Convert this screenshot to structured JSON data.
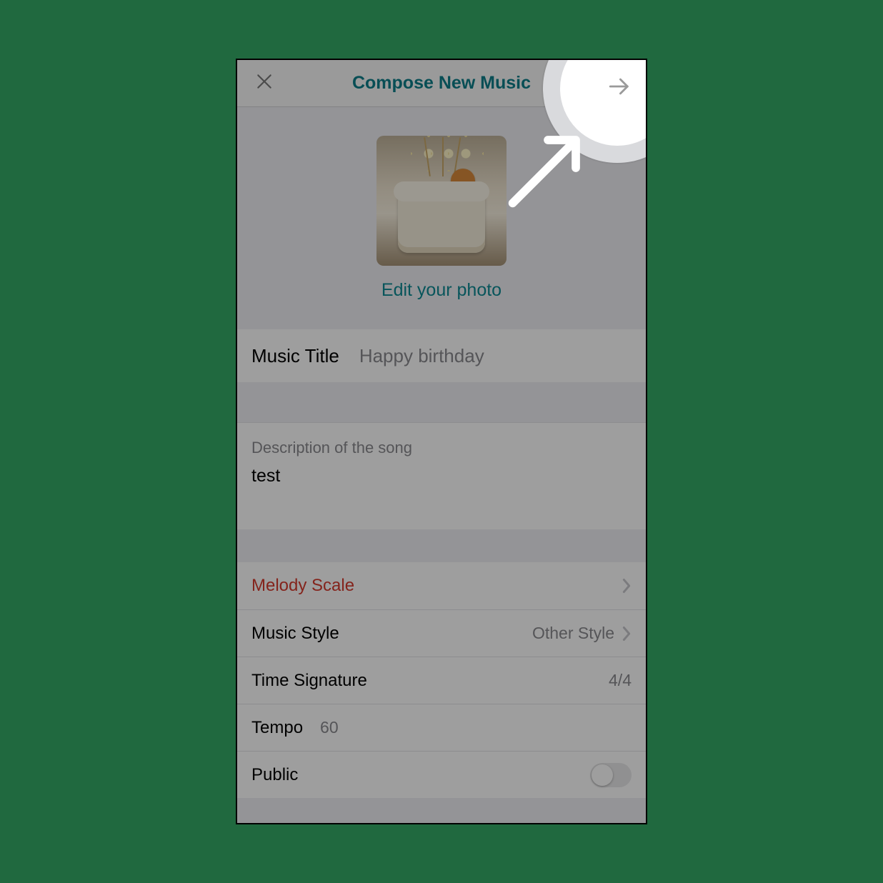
{
  "nav": {
    "title": "Compose New Music",
    "close_icon": "close-icon",
    "next_icon": "arrow-right-icon"
  },
  "photo": {
    "edit_label": "Edit your photo"
  },
  "title_field": {
    "label": "Music Title",
    "placeholder": "Happy birthday"
  },
  "description": {
    "header": "Description of the song",
    "value": "test"
  },
  "settings": {
    "melody_scale": {
      "label": "Melody Scale"
    },
    "music_style": {
      "label": "Music Style",
      "value": "Other Style"
    },
    "time_sig": {
      "label": "Time Signature",
      "value": "4/4"
    },
    "tempo": {
      "label": "Tempo",
      "value": "60"
    },
    "public": {
      "label": "Public",
      "on": false
    }
  }
}
